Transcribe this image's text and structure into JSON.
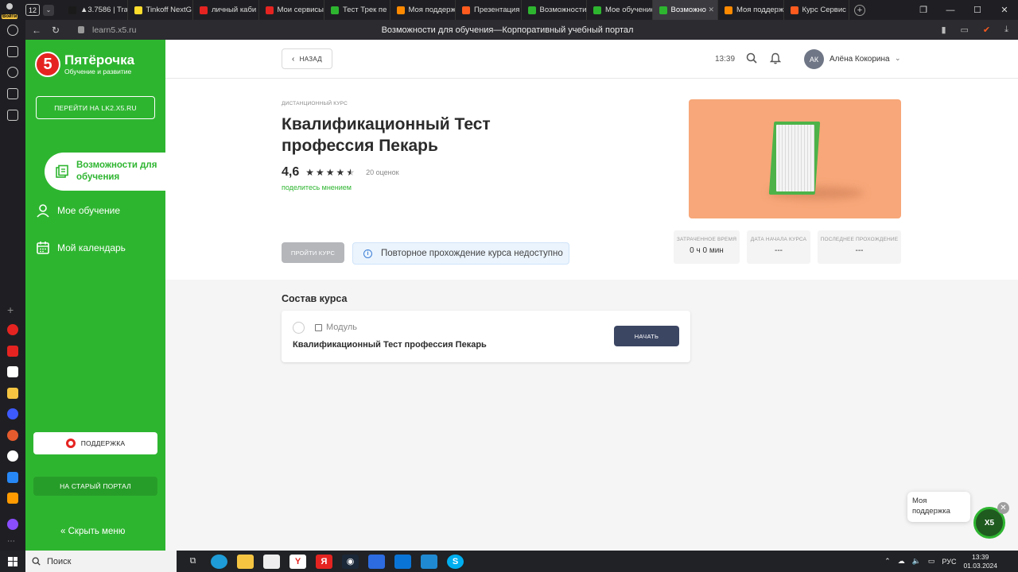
{
  "browser": {
    "tab_count": "12",
    "tabs": [
      {
        "label": "▲3.7586 | Tra",
        "color": "#1a1a1a"
      },
      {
        "label": "Tinkoff NextG",
        "color": "#ffdd2d"
      },
      {
        "label": "личный каби",
        "color": "#e52421"
      },
      {
        "label": "Мои сервисы",
        "color": "#e52421"
      },
      {
        "label": "Тест Трек пе",
        "color": "#2eb530"
      },
      {
        "label": "Моя поддерж",
        "color": "#ff8a00"
      },
      {
        "label": "Презентация",
        "color": "#ff5b1f"
      },
      {
        "label": "Возможности",
        "color": "#2eb530"
      },
      {
        "label": "Мое обучение",
        "color": "#2eb530"
      },
      {
        "label": "Возможно",
        "color": "#2eb530",
        "active": true
      },
      {
        "label": "Моя поддерж",
        "color": "#ff8a00"
      },
      {
        "label": "Курс Сервис",
        "color": "#ff5b1f"
      }
    ],
    "url": "learn5.x5.ru",
    "page_title": "Возможности для обучения—Корпоративный учебный портал"
  },
  "sidebar": {
    "brand": "Пятёрочка",
    "brand_sub": "Обучение и развитие",
    "logo_digit": "5",
    "lk_button": "ПЕРЕЙТИ НА LK2.X5.RU",
    "nav_active": "Возможности для обучения",
    "nav_items": [
      "Мое обучение",
      "Мой календарь"
    ],
    "support": "ПОДДЕРЖКА",
    "old_portal": "НА СТАРЫЙ ПОРТАЛ",
    "hide_menu": "Скрыть меню",
    "accent": "#2eb530"
  },
  "header": {
    "back": "НАЗАД",
    "time": "13:39",
    "avatar_initials": "АК",
    "user_name": "Алёна Кокорина"
  },
  "course": {
    "type": "ДИСТАНЦИОННЫЙ КУРС",
    "title": "Квалификационный Тест профессия Пекарь",
    "rating": "4,6",
    "rating_value": 4.6,
    "reviews": "20 оценок",
    "share": "поделитесь мнением",
    "take_button": "ПРОЙТИ КУРС",
    "notice": "Повторное прохождение курса недоступно",
    "stats": [
      {
        "label": "ЗАТРАЧЕННОЕ ВРЕМЯ",
        "value": "0 ч 0 мин"
      },
      {
        "label": "ДАТА НАЧАЛА КУРСА",
        "value": "---"
      },
      {
        "label": "ПОСЛЕДНЕЕ ПРОХОЖДЕНИЕ",
        "value": "---"
      }
    ]
  },
  "composition": {
    "title": "Состав курса",
    "module_type": "Модуль",
    "module_name": "Квалификационный Тест профессия Пекарь",
    "start_button": "НАЧАТЬ"
  },
  "chat": {
    "bubble": "Моя поддержка",
    "button": "X5"
  },
  "taskbar": {
    "search": "Поиск",
    "lang": "РУС",
    "time": "13:39",
    "date": "01.03.2024"
  }
}
